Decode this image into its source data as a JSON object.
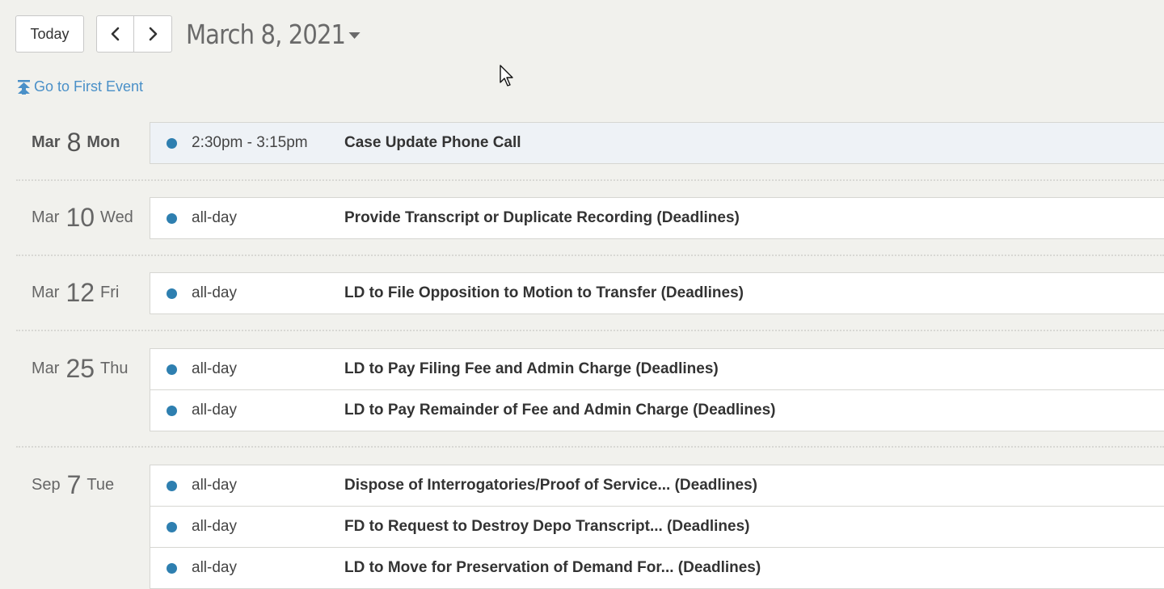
{
  "toolbar": {
    "today_label": "Today",
    "prev_icon": "chevron-left-icon",
    "next_icon": "chevron-right-icon",
    "current_date": "March 8, 2021",
    "dropdown_icon": "caret-down-icon"
  },
  "first_event_link": {
    "label": "Go to First Event",
    "icon": "jump-to-top-icon"
  },
  "colors": {
    "event_dot": "#2e7fb0",
    "link": "#4a90c8",
    "background": "#f1f1ed"
  },
  "days": [
    {
      "month": "Mar",
      "day": "8",
      "weekday": "Mon",
      "is_today": true,
      "events": [
        {
          "time": "2:30pm - 3:15pm",
          "title": "Case Update Phone Call"
        }
      ]
    },
    {
      "month": "Mar",
      "day": "10",
      "weekday": "Wed",
      "is_today": false,
      "events": [
        {
          "time": "all-day",
          "title": "Provide Transcript or Duplicate Recording (Deadlines)"
        }
      ]
    },
    {
      "month": "Mar",
      "day": "12",
      "weekday": "Fri",
      "is_today": false,
      "events": [
        {
          "time": "all-day",
          "title": "LD to File Opposition to Motion to Transfer (Deadlines)"
        }
      ]
    },
    {
      "month": "Mar",
      "day": "25",
      "weekday": "Thu",
      "is_today": false,
      "events": [
        {
          "time": "all-day",
          "title": "LD to Pay Filing Fee and Admin Charge (Deadlines)"
        },
        {
          "time": "all-day",
          "title": "LD to Pay Remainder of Fee and Admin Charge (Deadlines)"
        }
      ]
    },
    {
      "month": "Sep",
      "day": "7",
      "weekday": "Tue",
      "is_today": false,
      "events": [
        {
          "time": "all-day",
          "title": "Dispose of Interrogatories/Proof of Service... (Deadlines)"
        },
        {
          "time": "all-day",
          "title": "FD to Request to Destroy Depo Transcript... (Deadlines)"
        },
        {
          "time": "all-day",
          "title": "LD to Move for Preservation of Demand For... (Deadlines)"
        }
      ]
    }
  ]
}
